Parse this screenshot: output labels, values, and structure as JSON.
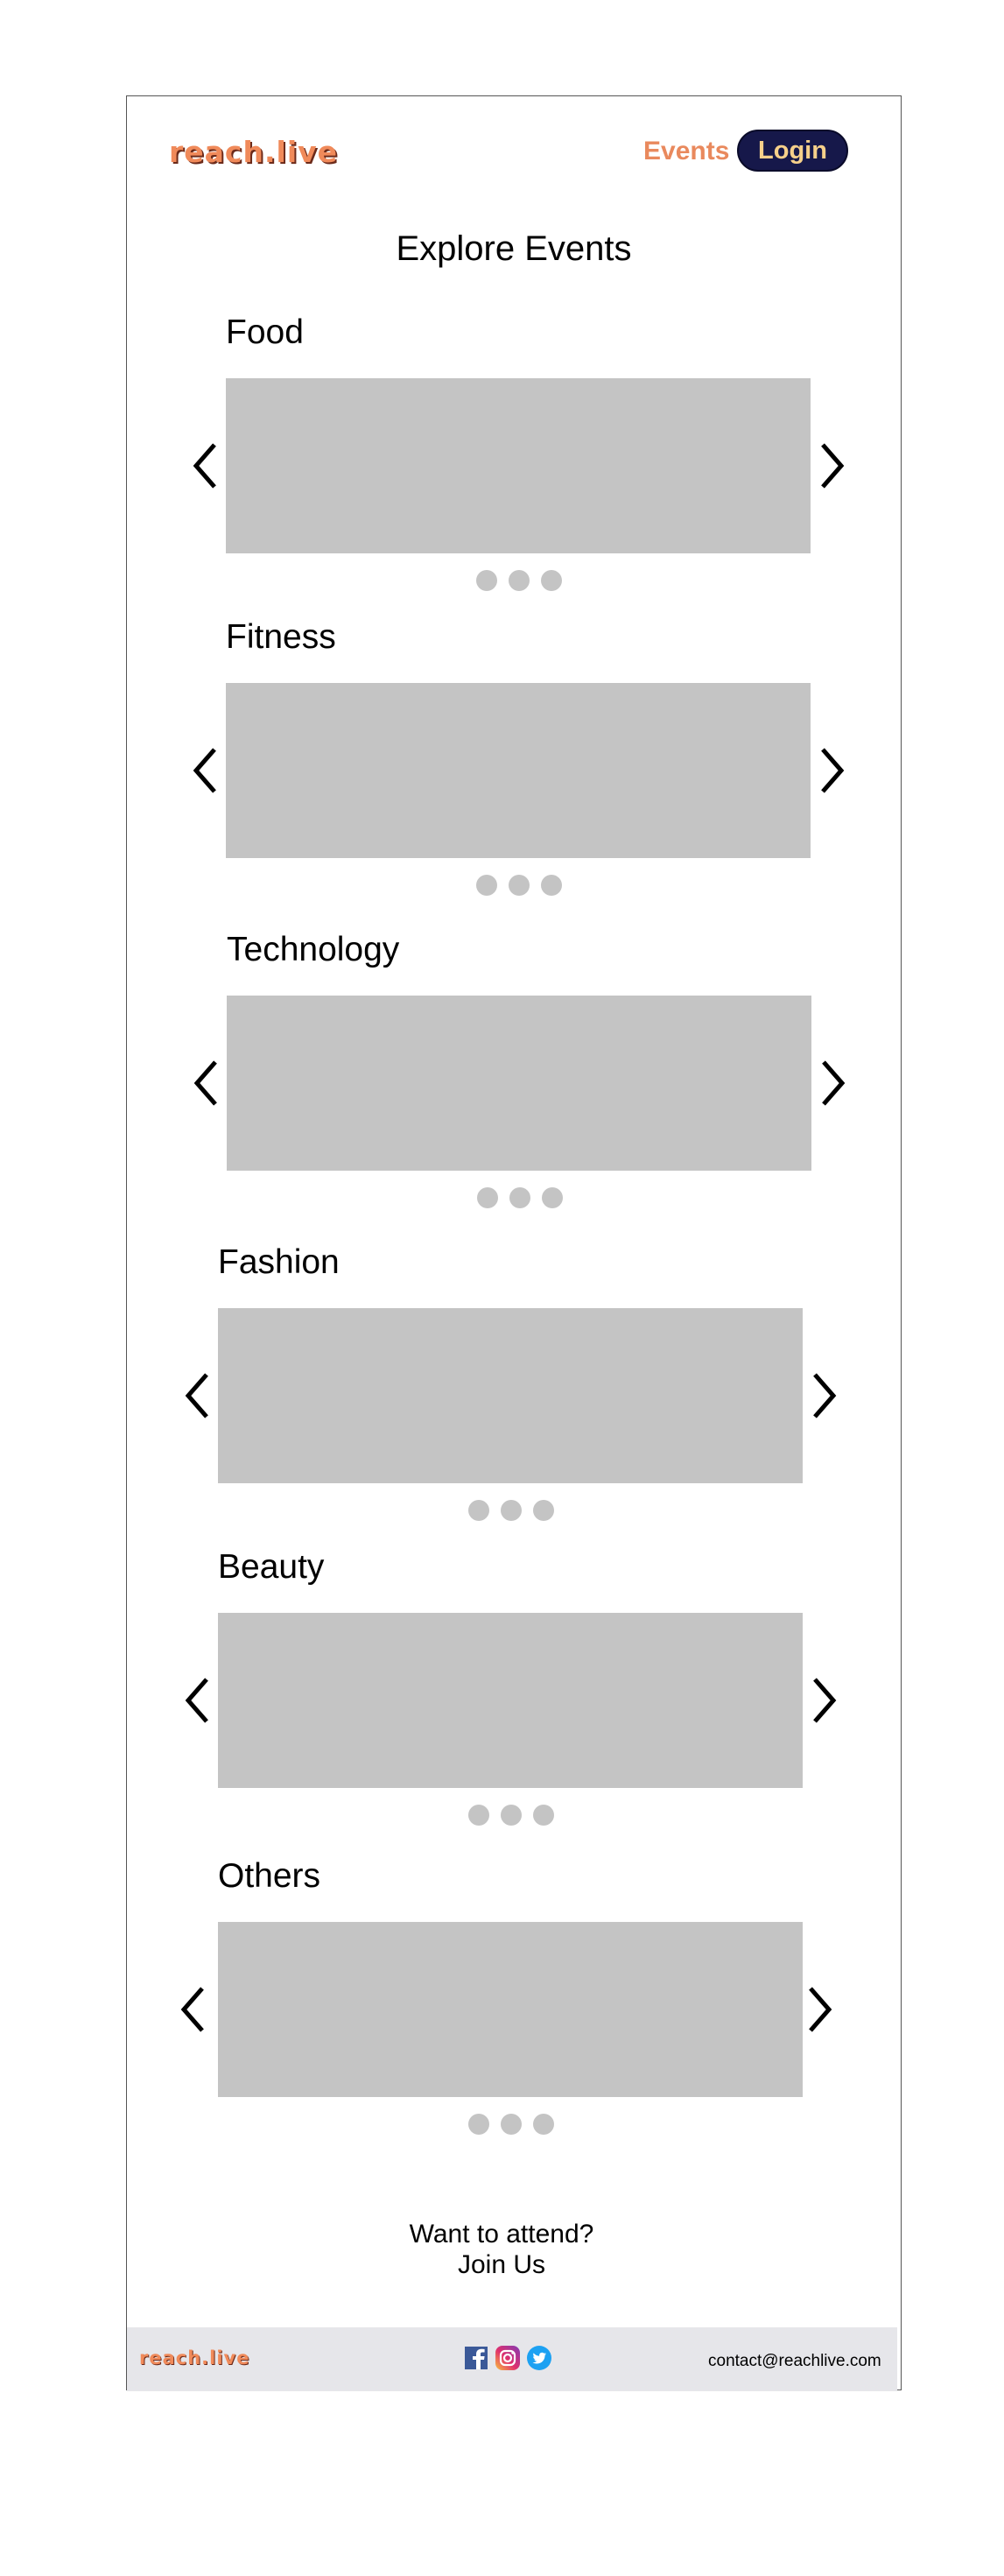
{
  "header": {
    "logo_text": "reach.live",
    "nav_events": "Events",
    "login_label": "Login"
  },
  "main": {
    "title": "Explore Events",
    "sections": [
      {
        "title": "Food"
      },
      {
        "title": "Fitness"
      },
      {
        "title": "Technology"
      },
      {
        "title": "Fashion"
      },
      {
        "title": "Beauty"
      },
      {
        "title": "Others"
      }
    ]
  },
  "cta": {
    "line1": "Want to attend?",
    "line2": "Join Us"
  },
  "footer": {
    "logo_text": "reach.live",
    "email": "contact@reachlive.com",
    "social_icons": [
      "facebook-icon",
      "instagram-icon",
      "twitter-icon"
    ]
  },
  "colors": {
    "accent": "#e9895d",
    "login_bg": "#16184a",
    "login_text": "#f6d08a",
    "placeholder": "#c4c4c4",
    "footer_bg": "#e6e6ea"
  }
}
